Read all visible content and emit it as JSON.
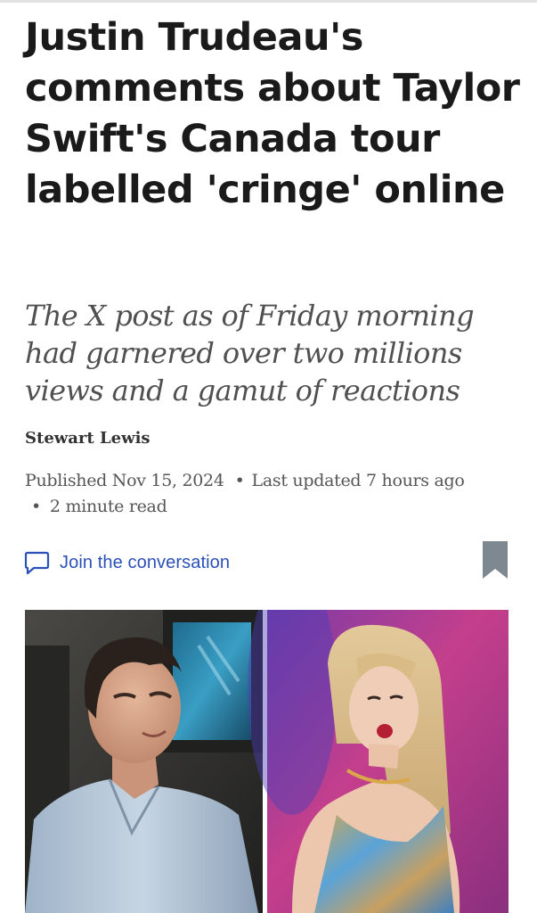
{
  "article": {
    "headline": "Justin Trudeau's comments about Taylor Swift's Canada tour labelled 'cringe' online",
    "dek": "The X post as of Friday morning had garnered over two millions views and a gamut of reactions",
    "author": "Stewart Lewis",
    "published": "Published Nov 15, 2024",
    "updated": "Last updated 7 hours ago",
    "read_time": "2 minute read"
  },
  "actions": {
    "join_label": "Join the conversation",
    "join_icon": "comment-icon",
    "bookmark_icon": "bookmark-icon"
  },
  "colors": {
    "headline": "#1a1a1a",
    "link": "#2b50b8",
    "bookmark": "#7e8891"
  }
}
